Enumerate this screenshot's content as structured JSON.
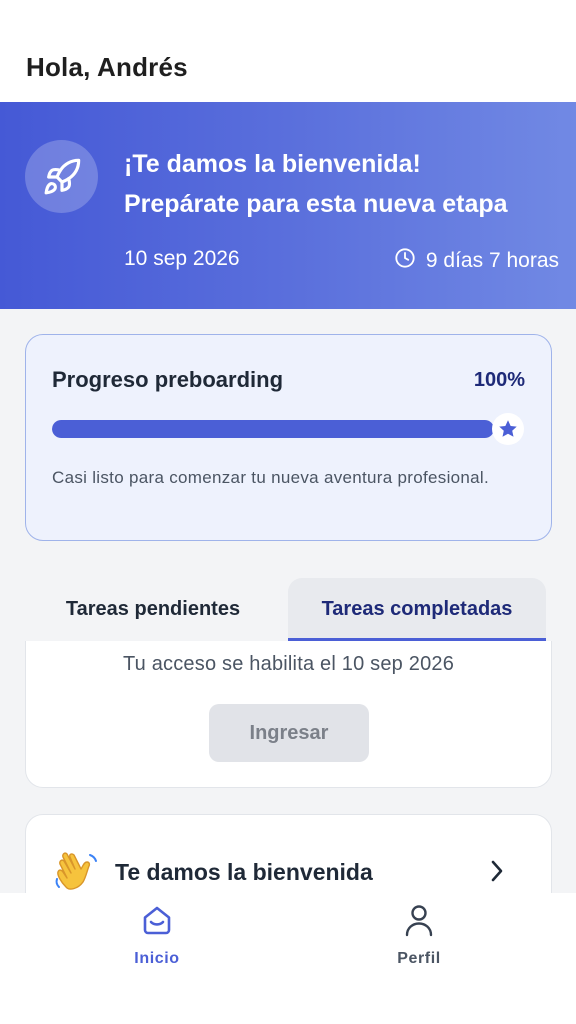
{
  "header": {
    "greeting": "Hola, Andrés"
  },
  "hero": {
    "icon": "rocket-icon",
    "title_line1": "¡Te damos la bienvenida!",
    "title_line2": "Prepárate para esta nueva etapa",
    "date": "10 sep 2026",
    "countdown_icon": "clock-icon",
    "countdown": "9 días 7 horas",
    "gradient_start": "#4559d6",
    "gradient_end": "#7189e4"
  },
  "progress": {
    "title": "Progreso preboarding",
    "percent_label": "100%",
    "value": 1.0,
    "marker_icon": "star-icon",
    "description": "Casi listo para comenzar tu nueva aventura profesional.",
    "accent": "#4b5fd6"
  },
  "tabs": [
    {
      "label": "Tareas pendientes",
      "active": false
    },
    {
      "label": "Tareas completadas",
      "active": true
    }
  ],
  "access": {
    "text": "Tu acceso se habilita el 10 sep 2026",
    "button_label": "Ingresar",
    "button_enabled": false
  },
  "welcome_item": {
    "icon": "waving-hand-icon",
    "label": "Te damos la bienvenida",
    "chevron": "chevron-right-icon"
  },
  "bottom_nav": [
    {
      "label": "Inicio",
      "icon": "home-icon",
      "active": true
    },
    {
      "label": "Perfil",
      "icon": "user-icon",
      "active": false
    }
  ]
}
